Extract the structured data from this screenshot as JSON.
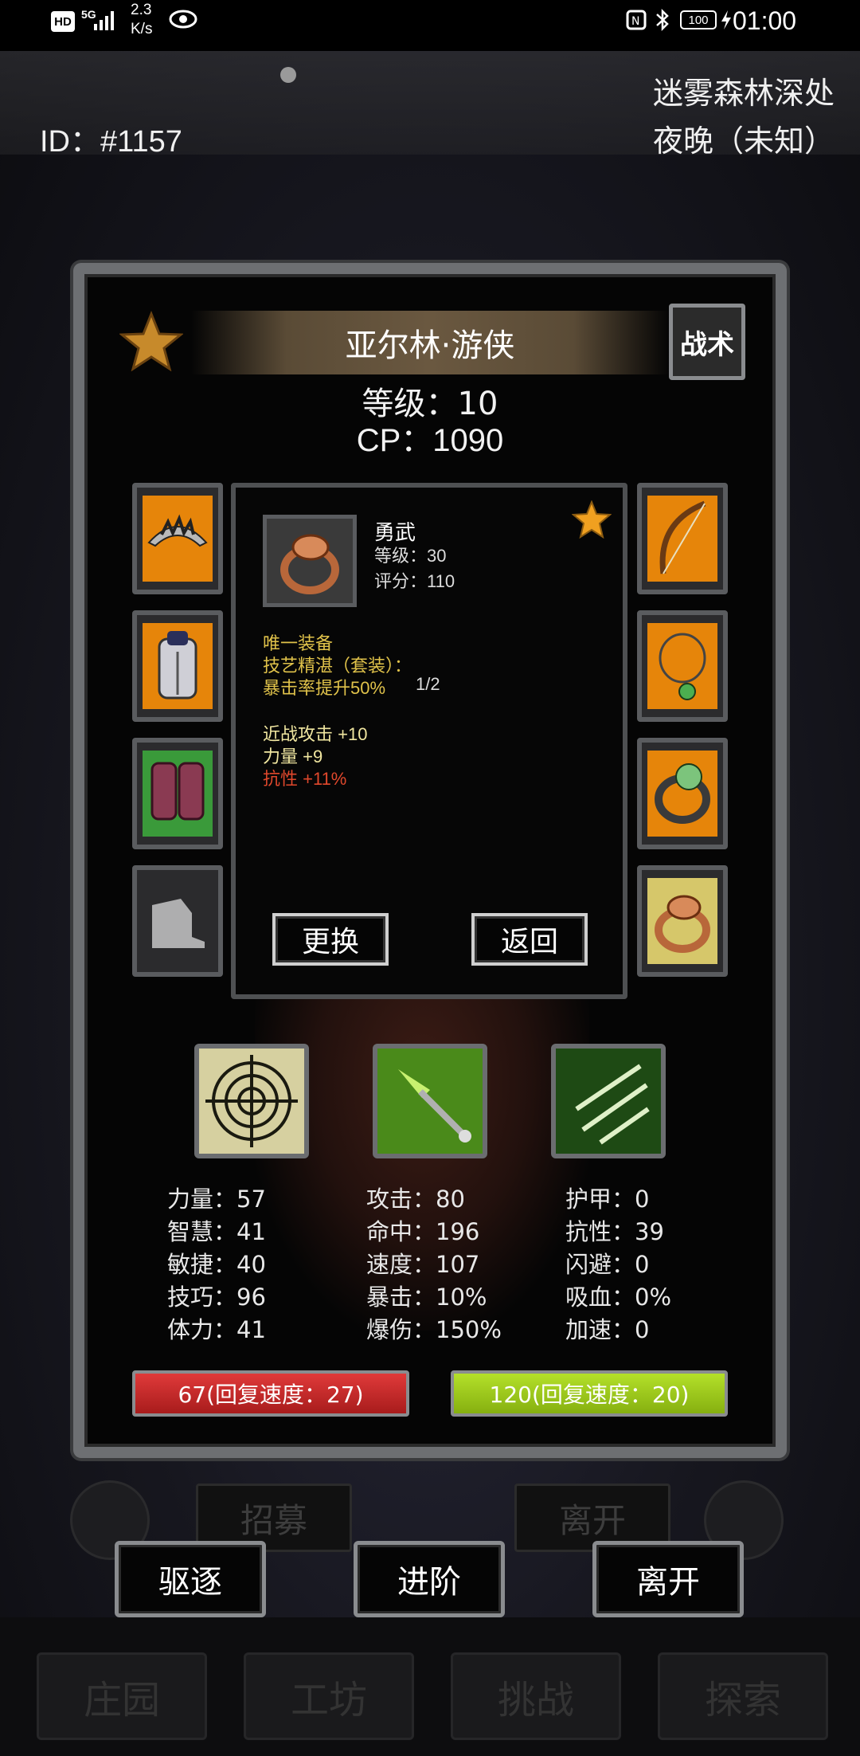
{
  "status_bar": {
    "hd": "HD",
    "network": "5G",
    "speed_value": "2.3",
    "speed_unit": "K/s",
    "battery": "100",
    "time": "01:00"
  },
  "header": {
    "player_id": "ID：#1157",
    "location": "迷雾森林深处",
    "time_of_day": "夜晚（未知）"
  },
  "hero": {
    "name": "亚尔林·游侠",
    "tactics_label": "战术",
    "level": "等级：10",
    "cp": "CP：1090"
  },
  "equipment_slots": {
    "left": [
      "helmet-icon",
      "chest-armor-icon",
      "gloves-icon",
      "boots-icon"
    ],
    "right": [
      "bow-icon",
      "amulet-icon",
      "skull-ring-icon",
      "ring-icon"
    ]
  },
  "tooltip": {
    "item_name": "勇武",
    "item_level": "等级：30",
    "item_score": "评分：110",
    "unique": "唯一装备",
    "set_name": "技艺精湛（套装）：",
    "set_bonus": "暴击率提升50%",
    "set_progress": "1/2",
    "attr1": "近战攻击 +10",
    "attr2": "力量 +9",
    "attr3": "抗性 +11%",
    "replace_label": "更换",
    "back_label": "返回"
  },
  "stats": {
    "col1": [
      "力量：57",
      "智慧：41",
      "敏捷：40",
      "技巧：96",
      "体力：41"
    ],
    "col2": [
      "攻击：80",
      "命中：196",
      "速度：107",
      "暴击：10%",
      "爆伤：150%"
    ],
    "col3": [
      "护甲：0",
      "抗性：39",
      "闪避：0",
      "吸血：0%",
      "加速：0"
    ]
  },
  "bars": {
    "hp": "67(回复速度：27)",
    "energy": "120(回复速度：20)"
  },
  "background_buttons": {
    "recruit": "招募",
    "leave_dim": "离开"
  },
  "actions": {
    "dismiss": "驱逐",
    "advance": "进阶",
    "leave": "离开"
  },
  "bottom_nav": [
    "庄园",
    "工坊",
    "挑战",
    "探索"
  ],
  "colors": {
    "tooltip_gold": "#e0c24a",
    "tooltip_red": "#e0482c",
    "hp_bar": "#c8262a",
    "energy_bar": "#9ccc1a"
  }
}
